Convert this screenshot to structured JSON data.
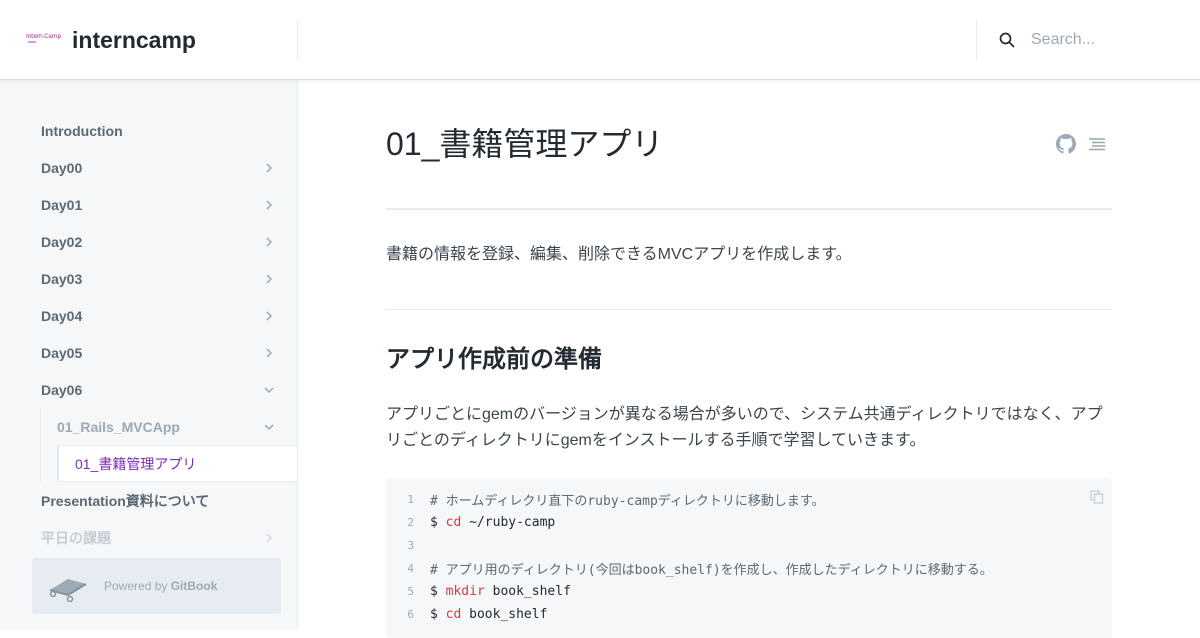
{
  "header": {
    "logo_text": "Intern.Camp",
    "brand": "interncamp",
    "search_placeholder": "Search..."
  },
  "sidebar": {
    "items": [
      {
        "label": "Introduction",
        "chevron": "none"
      },
      {
        "label": "Day00",
        "chevron": "right"
      },
      {
        "label": "Day01",
        "chevron": "right"
      },
      {
        "label": "Day02",
        "chevron": "right"
      },
      {
        "label": "Day03",
        "chevron": "right"
      },
      {
        "label": "Day04",
        "chevron": "right"
      },
      {
        "label": "Day05",
        "chevron": "right"
      },
      {
        "label": "Day06",
        "chevron": "down"
      }
    ],
    "sub_item": {
      "label": "01_Rails_MVCApp",
      "chevron": "down"
    },
    "active_item": {
      "label": "01_書籍管理アプリ"
    },
    "after_items": [
      {
        "label": "Presentation資料について"
      },
      {
        "label": "平日の課題"
      }
    ],
    "powered_by": {
      "prefix": "Powered by ",
      "brand": "GitBook"
    }
  },
  "main": {
    "title": "01_書籍管理アプリ",
    "intro": "書籍の情報を登録、編集、削除できるMVCアプリを作成します。",
    "section_heading": "アプリ作成前の準備",
    "paragraph": "アプリごとにgemのバージョンが異なる場合が多いので、システム共通ディレクトリではなく、アプリごとのディレクトリにgemをインストールする手順で学習していきます。",
    "code": {
      "lines": [
        {
          "n": "1",
          "prompt": "",
          "cmd": "",
          "text": "# ホームディレクリ直下のruby-campディレクトリに移動します。",
          "kind": "comment"
        },
        {
          "n": "2",
          "prompt": "$ ",
          "cmd": "cd",
          "text": " ~/ruby-camp",
          "kind": "command"
        },
        {
          "n": "3",
          "prompt": "",
          "cmd": "",
          "text": "",
          "kind": "blank"
        },
        {
          "n": "4",
          "prompt": "",
          "cmd": "",
          "text": "# アプリ用のディレクトリ(今回はbook_shelf)を作成し、作成したディレクトリに移動する。",
          "kind": "comment"
        },
        {
          "n": "5",
          "prompt": "$ ",
          "cmd": "mkdir",
          "text": " book_shelf",
          "kind": "command"
        },
        {
          "n": "6",
          "prompt": "$ ",
          "cmd": "cd",
          "text": " book_shelf",
          "kind": "command"
        }
      ]
    }
  },
  "colors": {
    "accent": "#7b2eb0",
    "sidebar_bg": "#f5f7f9",
    "code_cmd": "#d73a49"
  },
  "icons": [
    "search-icon",
    "chevron-right-icon",
    "chevron-down-icon",
    "gitbook-icon",
    "github-icon",
    "table-of-contents-icon",
    "copy-icon"
  ]
}
